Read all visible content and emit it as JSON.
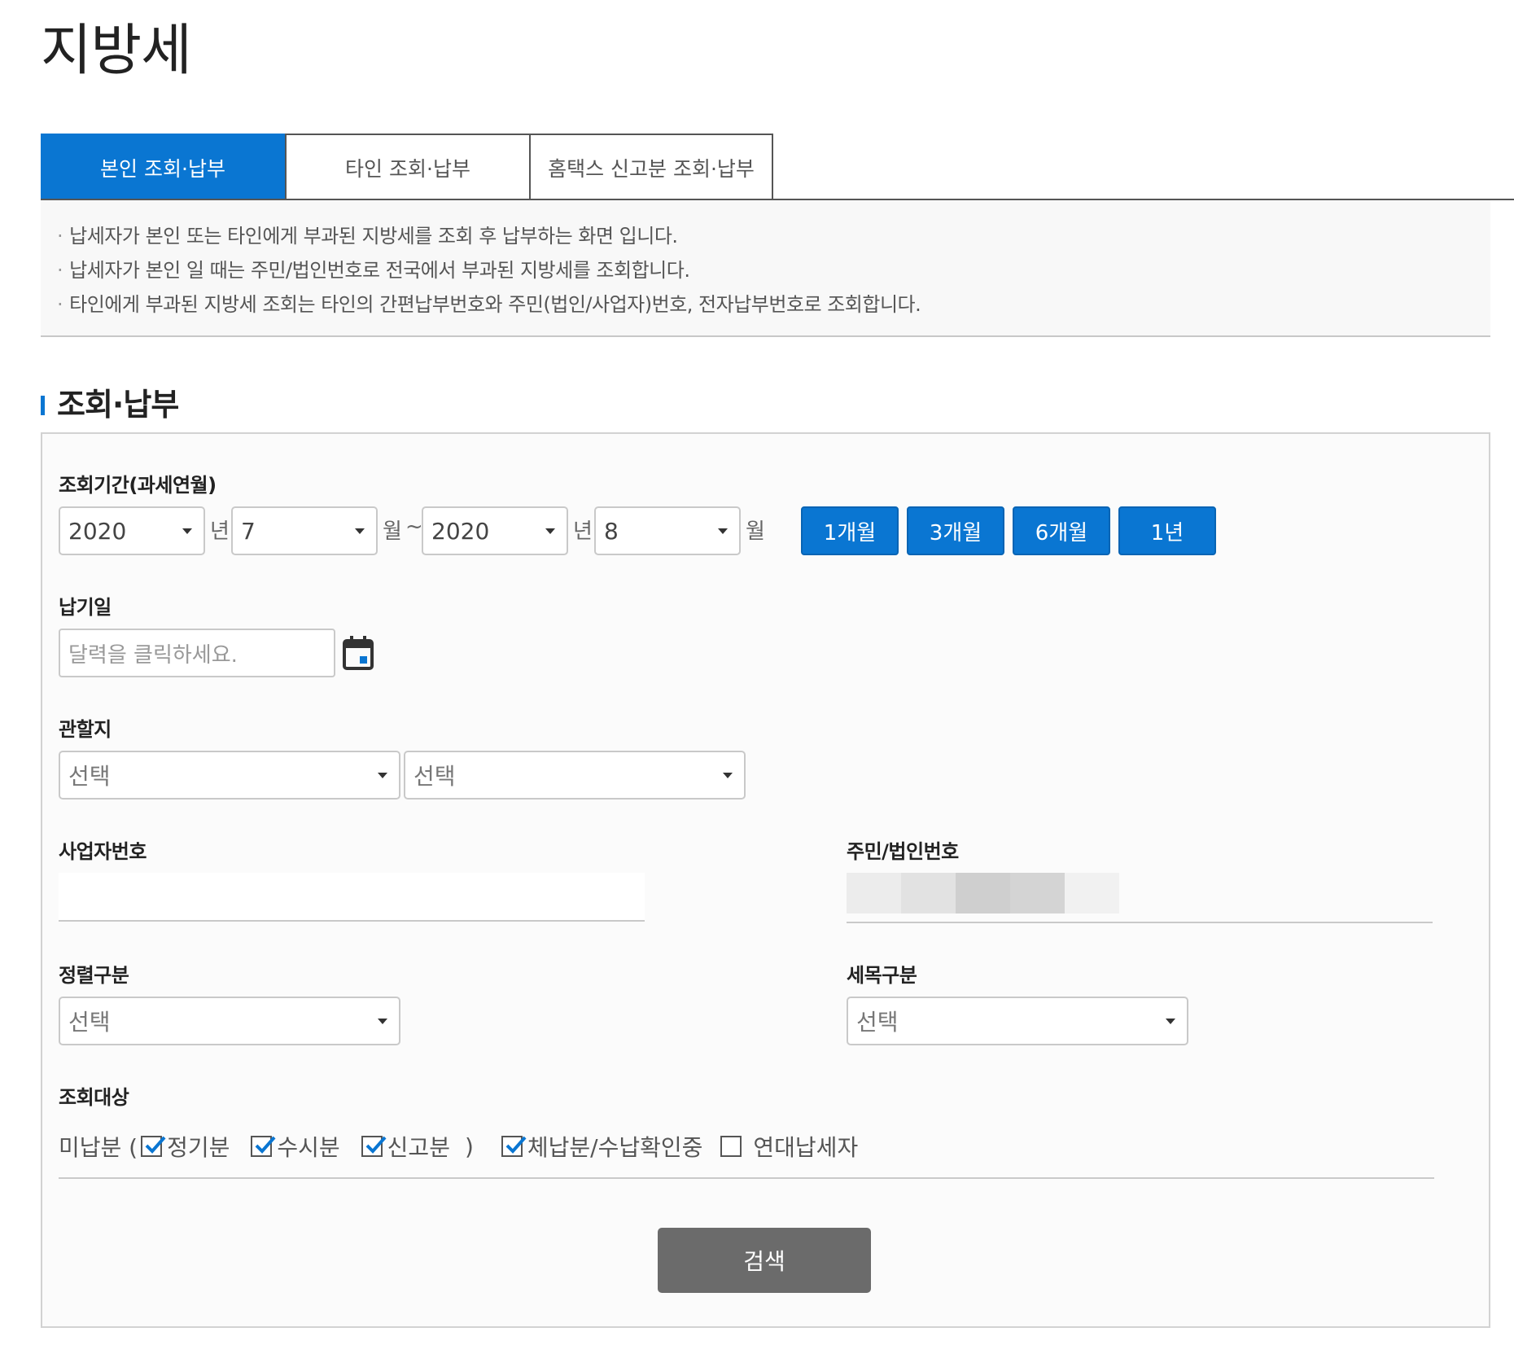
{
  "page": {
    "title": "지방세"
  },
  "tabs": [
    {
      "label": "본인 조회·납부",
      "active": true
    },
    {
      "label": "타인 조회·납부",
      "active": false
    },
    {
      "label": "홈택스 신고분 조회·납부",
      "active": false
    }
  ],
  "notices": [
    "납세자가 본인 또는 타인에게 부과된 지방세를 조회 후 납부하는 화면 입니다.",
    "납세자가 본인 일 때는 주민/법인번호로 전국에서 부과된 지방세를 조회합니다.",
    "타인에게 부과된 지방세 조회는 타인의 간편납부번호와 주민(법인/사업자)번호, 전자납부번호로 조회합니다."
  ],
  "section": {
    "title": "조회·납부"
  },
  "period": {
    "label": "조회기간(과세연월)",
    "from_year": "2020",
    "year_unit": "년",
    "from_month": "7",
    "month_unit": "월",
    "tilde": "~",
    "to_year": "2020",
    "to_month": "8",
    "quick_buttons": [
      "1개월",
      "3개월",
      "6개월",
      "1년"
    ]
  },
  "due_date": {
    "label": "납기일",
    "placeholder": "달력을 클릭하세요."
  },
  "jurisdiction": {
    "label": "관할지",
    "select1": "선택",
    "select2": "선택"
  },
  "business_no": {
    "label": "사업자번호",
    "value": ""
  },
  "resident_no": {
    "label": "주민/법인번호"
  },
  "sort": {
    "label": "정렬구분",
    "value": "선택"
  },
  "tax_item": {
    "label": "세목구분",
    "value": "선택"
  },
  "target": {
    "label": "조회대상",
    "unpaid_prefix": "미납분 (",
    "options": [
      {
        "label": "정기분",
        "checked": true
      },
      {
        "label": "수시분",
        "checked": true
      },
      {
        "label": "신고분",
        "checked": true
      }
    ],
    "close_paren": ")",
    "overdue": {
      "label": "체납분/수납확인중",
      "checked": true
    },
    "joint": {
      "label": "연대납세자",
      "checked": false
    }
  },
  "search_button": "검색",
  "colors": {
    "primary": "#0a76d2",
    "search": "#6b6b6b"
  }
}
